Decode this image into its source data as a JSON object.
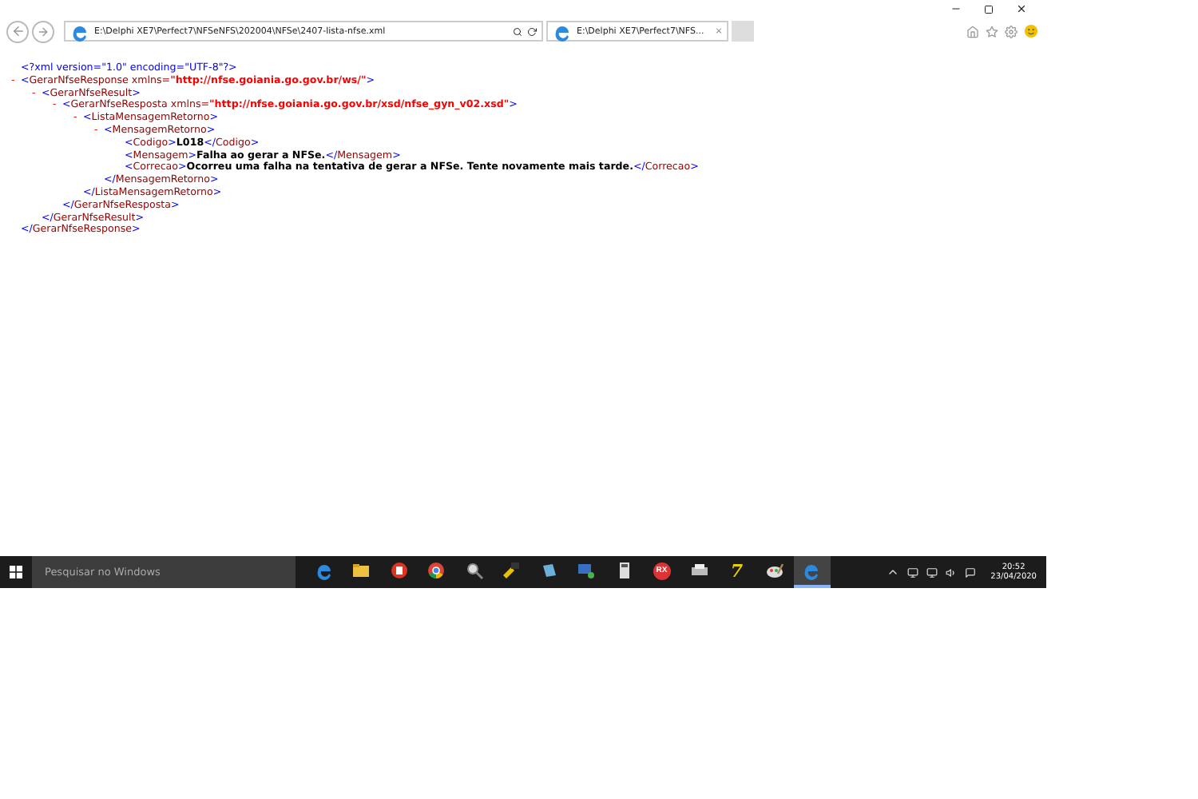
{
  "browser": {
    "address": "E:\\Delphi XE7\\Perfect7\\NFSeNFS\\202004\\NFSe\\2407-lista-nfse.xml",
    "tabs": [
      {
        "title": "E:\\Delphi XE7\\Perfect7\\NFS...",
        "close": "×",
        "selected": true
      }
    ]
  },
  "xml": {
    "declaration": [
      {
        "kind": "punct",
        "text": "<?xml version=\"1.0\" encoding=\"UTF-8\"?>"
      }
    ],
    "root": {
      "toggle": "-",
      "open": [
        {
          "kind": "punct",
          "text": "<"
        },
        {
          "kind": "name",
          "text": "GerarNfseResponse"
        },
        {
          "kind": "attr",
          "text": " xmlns="
        },
        {
          "kind": "value",
          "text": "\"http://nfse.goiania.go.gov.br/ws/\""
        },
        {
          "kind": "punct",
          "text": ">"
        }
      ],
      "close": [
        {
          "kind": "punct",
          "text": "</"
        },
        {
          "kind": "name",
          "text": "GerarNfseResponse"
        },
        {
          "kind": "punct",
          "text": ">"
        }
      ],
      "children": [
        {
          "toggle": "-",
          "open": [
            {
              "kind": "punct",
              "text": "<"
            },
            {
              "kind": "name",
              "text": "GerarNfseResult"
            },
            {
              "kind": "punct",
              "text": ">"
            }
          ],
          "close": [
            {
              "kind": "punct",
              "text": "</"
            },
            {
              "kind": "name",
              "text": "GerarNfseResult"
            },
            {
              "kind": "punct",
              "text": ">"
            }
          ],
          "children": [
            {
              "toggle": "-",
              "open": [
                {
                  "kind": "punct",
                  "text": "<"
                },
                {
                  "kind": "name",
                  "text": "GerarNfseResposta"
                },
                {
                  "kind": "attr",
                  "text": " xmlns="
                },
                {
                  "kind": "value",
                  "text": "\"http://nfse.goiania.go.gov.br/xsd/nfse_gyn_v02.xsd\""
                },
                {
                  "kind": "punct",
                  "text": ">"
                }
              ],
              "close": [
                {
                  "kind": "punct",
                  "text": "</"
                },
                {
                  "kind": "name",
                  "text": "GerarNfseResposta"
                },
                {
                  "kind": "punct",
                  "text": ">"
                }
              ],
              "children": [
                {
                  "toggle": "-",
                  "open": [
                    {
                      "kind": "punct",
                      "text": "<"
                    },
                    {
                      "kind": "name",
                      "text": "ListaMensagemRetorno"
                    },
                    {
                      "kind": "punct",
                      "text": ">"
                    }
                  ],
                  "close": [
                    {
                      "kind": "punct",
                      "text": "</"
                    },
                    {
                      "kind": "name",
                      "text": "ListaMensagemRetorno"
                    },
                    {
                      "kind": "punct",
                      "text": ">"
                    }
                  ],
                  "children": [
                    {
                      "toggle": "-",
                      "open": [
                        {
                          "kind": "punct",
                          "text": "<"
                        },
                        {
                          "kind": "name",
                          "text": "MensagemRetorno"
                        },
                        {
                          "kind": "punct",
                          "text": ">"
                        }
                      ],
                      "close": [
                        {
                          "kind": "punct",
                          "text": "</"
                        },
                        {
                          "kind": "name",
                          "text": "MensagemRetorno"
                        },
                        {
                          "kind": "punct",
                          "text": ">"
                        }
                      ],
                      "children": [
                        {
                          "open": [
                            {
                              "kind": "punct",
                              "text": "<"
                            },
                            {
                              "kind": "name",
                              "text": "Codigo"
                            },
                            {
                              "kind": "punct",
                              "text": ">"
                            },
                            {
                              "kind": "content",
                              "text": "L018"
                            },
                            {
                              "kind": "punct",
                              "text": "</"
                            },
                            {
                              "kind": "name",
                              "text": "Codigo"
                            },
                            {
                              "kind": "punct",
                              "text": ">"
                            }
                          ]
                        },
                        {
                          "open": [
                            {
                              "kind": "punct",
                              "text": "<"
                            },
                            {
                              "kind": "name",
                              "text": "Mensagem"
                            },
                            {
                              "kind": "punct",
                              "text": ">"
                            },
                            {
                              "kind": "content",
                              "text": "Falha ao gerar a NFSe."
                            },
                            {
                              "kind": "punct",
                              "text": "</"
                            },
                            {
                              "kind": "name",
                              "text": "Mensagem"
                            },
                            {
                              "kind": "punct",
                              "text": ">"
                            }
                          ]
                        },
                        {
                          "open": [
                            {
                              "kind": "punct",
                              "text": "<"
                            },
                            {
                              "kind": "name",
                              "text": "Correcao"
                            },
                            {
                              "kind": "punct",
                              "text": ">"
                            },
                            {
                              "kind": "content",
                              "text": "Ocorreu uma falha na tentativa de gerar a NFSe. Tente novamente mais tarde."
                            },
                            {
                              "kind": "punct",
                              "text": "</"
                            },
                            {
                              "kind": "name",
                              "text": "Correcao"
                            },
                            {
                              "kind": "punct",
                              "text": ">"
                            }
                          ]
                        }
                      ]
                    }
                  ]
                }
              ]
            }
          ]
        }
      ]
    }
  },
  "taskbar": {
    "search": {
      "placeholder": "Pesquisar no Windows"
    },
    "apps": [
      {
        "kind": "edge",
        "selected": false
      },
      {
        "kind": "folder",
        "selected": false
      },
      {
        "kind": "trash",
        "selected": false
      },
      {
        "kind": "chrome",
        "selected": false
      },
      {
        "kind": "magnifier",
        "selected": false
      },
      {
        "kind": "tool",
        "selected": false
      },
      {
        "kind": "doc",
        "selected": false
      },
      {
        "kind": "computer",
        "selected": false
      },
      {
        "kind": "calculator",
        "selected": false
      },
      {
        "kind": "badge",
        "label": "RX",
        "selected": false
      },
      {
        "kind": "printer",
        "selected": false
      },
      {
        "kind": "logo",
        "label": "7",
        "selected": false
      },
      {
        "kind": "palette",
        "selected": false
      },
      {
        "kind": "edge",
        "selected": true
      }
    ],
    "time": "20:52",
    "date": "23/04/2020"
  }
}
